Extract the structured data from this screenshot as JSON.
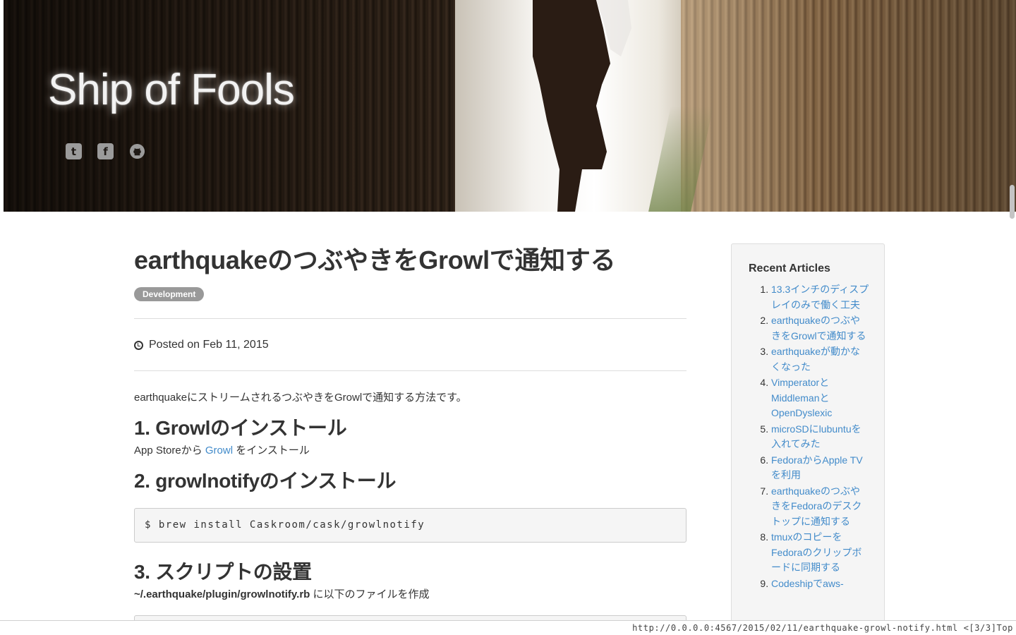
{
  "site": {
    "title": "Ship of Fools",
    "social": [
      {
        "icon": "twitter-icon",
        "glyph": "t"
      },
      {
        "icon": "facebook-icon",
        "glyph": "f"
      },
      {
        "icon": "github-icon",
        "glyph": "◉"
      }
    ]
  },
  "post": {
    "title": "earthquakeのつぶやきをGrowlで通知する",
    "tag": "Development",
    "posted": "Posted on Feb 11, 2015",
    "lead": "earthquakeにストリームされるつぶやきをGrowlで通知する方法です。",
    "sections": [
      {
        "heading": "1. Growlのインストール",
        "text_before": "App Storeから ",
        "link": "Growl",
        "text_after": " をインストール"
      },
      {
        "heading": "2. growlnotifyのインストール",
        "code": "$ brew install Caskroom/cask/growlnotify"
      },
      {
        "heading": "3. スクリプトの設置",
        "path": "~/.earthquake/plugin/growlnotify.rb",
        "text_after": " に以下のファイルを作成"
      }
    ]
  },
  "sidebar": {
    "heading": "Recent Articles",
    "articles": [
      "13.3インチのディスプレイのみで働く工夫",
      "earthquakeのつぶやきをGrowlで通知する",
      "earthquakeが動かなくなった",
      "VimperatorとMiddlemanとOpenDyslexic",
      "microSDにlubuntuを入れてみた",
      "FedoraからApple TVを利用",
      "earthquakeのつぶやきをFedoraのデスクトップに通知する",
      "tmuxのコピーをFedoraのクリップボードに同期する",
      "Codeshipでaws-"
    ]
  },
  "status": {
    "url": "http://0.0.0.0:4567/2015/02/11/earthquake-growl-notify.html",
    "position": "<[3/3]Top"
  },
  "colors": {
    "link": "#428bca",
    "tag_bg": "#999999",
    "code_bg": "#f5f5f5"
  }
}
